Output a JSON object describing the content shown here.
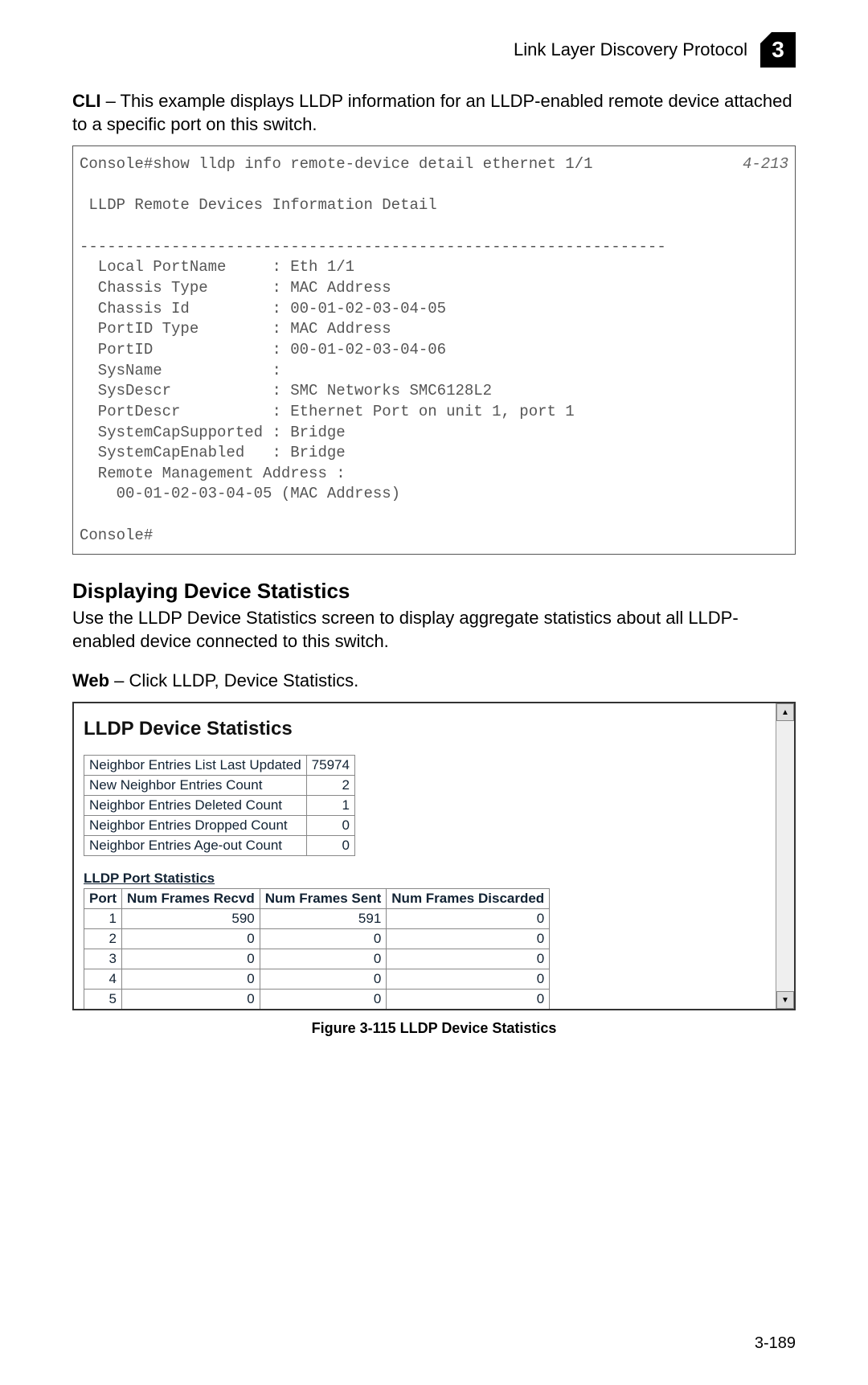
{
  "header": {
    "title": "Link Layer Discovery Protocol",
    "chapter": "3"
  },
  "intro": {
    "cli_label": "CLI",
    "cli_text": " – This example displays LLDP information for an LLDP-enabled remote device attached to a specific port on this switch."
  },
  "console": {
    "ref": "4-213",
    "lines": "Console#show lldp info remote-device detail ethernet 1/1\n\n LLDP Remote Devices Information Detail\n\n----------------------------------------------------------------\n  Local PortName     : Eth 1/1\n  Chassis Type       : MAC Address\n  Chassis Id         : 00-01-02-03-04-05\n  PortID Type        : MAC Address\n  PortID             : 00-01-02-03-04-06\n  SysName            :\n  SysDescr           : SMC Networks SMC6128L2\n  PortDescr          : Ethernet Port on unit 1, port 1\n  SystemCapSupported : Bridge\n  SystemCapEnabled   : Bridge\n  Remote Management Address :\n    00-01-02-03-04-05 (MAC Address)\n\nConsole#"
  },
  "section": {
    "title": "Displaying Device Statistics",
    "text": "Use the LLDP Device Statistics screen to display aggregate statistics about all LLDP-enabled device connected to this switch.",
    "web_label": "Web",
    "web_text": " – Click LLDP, Device Statistics."
  },
  "screenshot": {
    "heading": "LLDP Device Statistics",
    "summary_rows": [
      {
        "label": "Neighbor Entries List Last Updated",
        "value": "75974"
      },
      {
        "label": "New Neighbor Entries Count",
        "value": "2"
      },
      {
        "label": "Neighbor Entries Deleted Count",
        "value": "1"
      },
      {
        "label": "Neighbor Entries Dropped Count",
        "value": "0"
      },
      {
        "label": "Neighbor Entries Age-out Count",
        "value": "0"
      }
    ],
    "port_title": "LLDP Port Statistics",
    "port_headers": [
      "Port",
      "Num Frames Recvd",
      "Num Frames Sent",
      "Num Frames Discarded"
    ],
    "port_rows": [
      {
        "port": "1",
        "recvd": "590",
        "sent": "591",
        "disc": "0"
      },
      {
        "port": "2",
        "recvd": "0",
        "sent": "0",
        "disc": "0"
      },
      {
        "port": "3",
        "recvd": "0",
        "sent": "0",
        "disc": "0"
      },
      {
        "port": "4",
        "recvd": "0",
        "sent": "0",
        "disc": "0"
      },
      {
        "port": "5",
        "recvd": "0",
        "sent": "0",
        "disc": "0"
      }
    ]
  },
  "figure_caption": "Figure 3-115  LLDP Device Statistics",
  "page_number": "3-189"
}
